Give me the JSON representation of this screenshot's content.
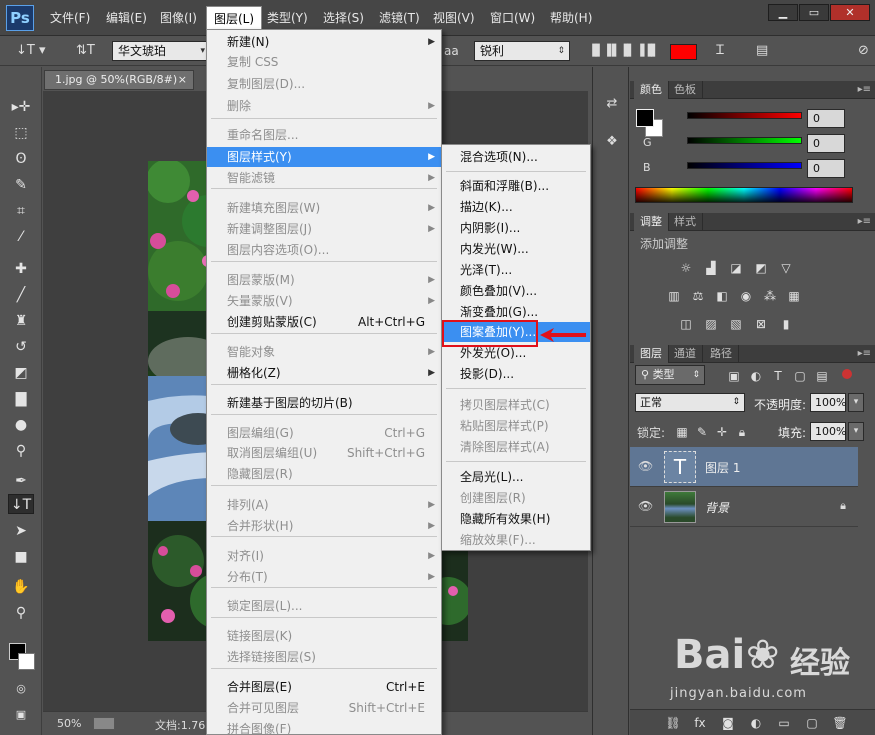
{
  "app": {
    "logo": "Ps"
  },
  "menubar": {
    "items": [
      "文件(F)",
      "编辑(E)",
      "图像(I)",
      "图层(L)",
      "类型(Y)",
      "选择(S)",
      "滤镜(T)",
      "视图(V)",
      "窗口(W)",
      "帮助(H)"
    ],
    "active_index": 3,
    "window_buttons": [
      "▁",
      "▭",
      "✕"
    ]
  },
  "options": {
    "font_family": "华文琥珀",
    "aa_label": "aa",
    "aa_value": "锐利",
    "text_color": "#ff0000"
  },
  "document": {
    "tab_title": "1.jpg @ 50%(RGB/8#)",
    "close": "×",
    "zoom": "50%",
    "status": "文档:1.76"
  },
  "layer_menu": {
    "items": [
      {
        "label": "新建(N)",
        "shortcut": "",
        "submenu": true,
        "disabled": false
      },
      {
        "label": "复制 CSS",
        "shortcut": "",
        "submenu": false,
        "disabled": true
      },
      {
        "label": "复制图层(D)...",
        "shortcut": "",
        "submenu": false,
        "disabled": true
      },
      {
        "label": "删除",
        "shortcut": "",
        "submenu": true,
        "disabled": true
      },
      {
        "label": "重命名图层...",
        "shortcut": "",
        "submenu": false,
        "disabled": true
      },
      {
        "label": "图层样式(Y)",
        "shortcut": "",
        "submenu": true,
        "disabled": false,
        "highlighted": true
      },
      {
        "label": "智能滤镜",
        "shortcut": "",
        "submenu": true,
        "disabled": true
      },
      {
        "label": "新建填充图层(W)",
        "shortcut": "",
        "submenu": true,
        "disabled": true
      },
      {
        "label": "新建调整图层(J)",
        "shortcut": "",
        "submenu": true,
        "disabled": true
      },
      {
        "label": "图层内容选项(O)...",
        "shortcut": "",
        "submenu": false,
        "disabled": true
      },
      {
        "label": "图层蒙版(M)",
        "shortcut": "",
        "submenu": true,
        "disabled": true
      },
      {
        "label": "矢量蒙版(V)",
        "shortcut": "",
        "submenu": true,
        "disabled": true
      },
      {
        "label": "创建剪贴蒙版(C)",
        "shortcut": "Alt+Ctrl+G",
        "submenu": false,
        "disabled": false
      },
      {
        "label": "智能对象",
        "shortcut": "",
        "submenu": true,
        "disabled": true
      },
      {
        "label": "栅格化(Z)",
        "shortcut": "",
        "submenu": true,
        "disabled": false
      },
      {
        "label": "新建基于图层的切片(B)",
        "shortcut": "",
        "submenu": false,
        "disabled": false
      },
      {
        "label": "图层编组(G)",
        "shortcut": "Ctrl+G",
        "submenu": false,
        "disabled": true
      },
      {
        "label": "取消图层编组(U)",
        "shortcut": "Shift+Ctrl+G",
        "submenu": false,
        "disabled": true
      },
      {
        "label": "隐藏图层(R)",
        "shortcut": "",
        "submenu": false,
        "disabled": true
      },
      {
        "label": "排列(A)",
        "shortcut": "",
        "submenu": true,
        "disabled": true
      },
      {
        "label": "合并形状(H)",
        "shortcut": "",
        "submenu": true,
        "disabled": true
      },
      {
        "label": "对齐(I)",
        "shortcut": "",
        "submenu": true,
        "disabled": true
      },
      {
        "label": "分布(T)",
        "shortcut": "",
        "submenu": true,
        "disabled": true
      },
      {
        "label": "锁定图层(L)...",
        "shortcut": "",
        "submenu": false,
        "disabled": true
      },
      {
        "label": "链接图层(K)",
        "shortcut": "",
        "submenu": false,
        "disabled": true
      },
      {
        "label": "选择链接图层(S)",
        "shortcut": "",
        "submenu": false,
        "disabled": true
      },
      {
        "label": "合并图层(E)",
        "shortcut": "Ctrl+E",
        "submenu": false,
        "disabled": false
      },
      {
        "label": "合并可见图层",
        "shortcut": "Shift+Ctrl+E",
        "submenu": false,
        "disabled": true
      },
      {
        "label": "拼合图像(F)",
        "shortcut": "",
        "submenu": false,
        "disabled": true
      }
    ]
  },
  "style_submenu": {
    "items": [
      {
        "label": "混合选项(N)...",
        "disabled": false
      },
      {
        "label": "斜面和浮雕(B)...",
        "disabled": false
      },
      {
        "label": "描边(K)...",
        "disabled": false
      },
      {
        "label": "内阴影(I)...",
        "disabled": false
      },
      {
        "label": "内发光(W)...",
        "disabled": false
      },
      {
        "label": "光泽(T)...",
        "disabled": false
      },
      {
        "label": "颜色叠加(V)...",
        "disabled": false
      },
      {
        "label": "渐变叠加(G)...",
        "disabled": false
      },
      {
        "label": "图案叠加(Y)...",
        "disabled": false,
        "highlighted": true
      },
      {
        "label": "外发光(O)...",
        "disabled": false
      },
      {
        "label": "投影(D)...",
        "disabled": false
      },
      {
        "label": "拷贝图层样式(C)",
        "disabled": true
      },
      {
        "label": "粘贴图层样式(P)",
        "disabled": true
      },
      {
        "label": "清除图层样式(A)",
        "disabled": true
      },
      {
        "label": "全局光(L)...",
        "disabled": false
      },
      {
        "label": "创建图层(R)",
        "disabled": true
      },
      {
        "label": "隐藏所有效果(H)",
        "disabled": false
      },
      {
        "label": "缩放效果(F)...",
        "disabled": true
      }
    ]
  },
  "color_panel": {
    "tabs": [
      "颜色",
      "色板"
    ],
    "channels": [
      {
        "label": "R",
        "value": "0",
        "color": "#ff0000"
      },
      {
        "label": "G",
        "value": "0",
        "color": "#00ff00"
      },
      {
        "label": "B",
        "value": "0",
        "color": "#0000ff"
      }
    ]
  },
  "adjust_panel": {
    "tabs": [
      "调整",
      "样式"
    ],
    "title": "添加调整"
  },
  "layers_panel": {
    "tabs": [
      "图层",
      "通道",
      "路径"
    ],
    "filter_label": "类型",
    "blend_mode": "正常",
    "opacity_label": "不透明度:",
    "opacity": "100%",
    "lock_label": "锁定:",
    "fill_label": "填充:",
    "fill": "100%",
    "layers": [
      {
        "name": "图层 1",
        "thumb": "T",
        "selected": true
      },
      {
        "name": "背景",
        "thumb": "",
        "selected": false
      }
    ]
  },
  "watermark": {
    "brand": "Bai",
    "brand2": "经验",
    "url": "jingyan.baidu.com"
  }
}
